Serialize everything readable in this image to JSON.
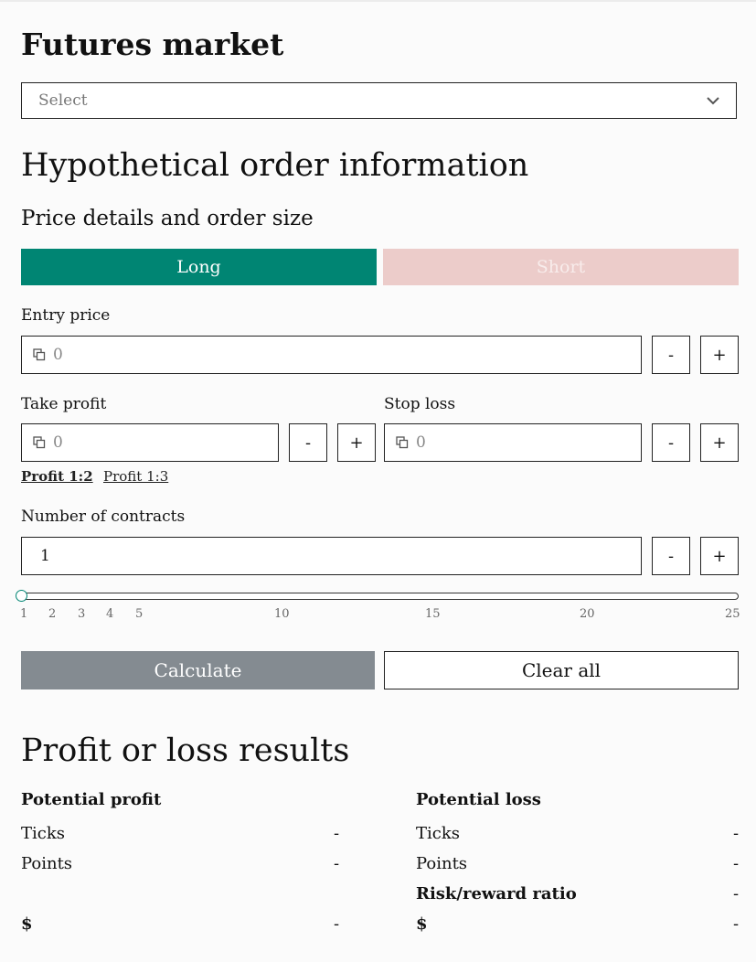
{
  "futures": {
    "title": "Futures market",
    "select_placeholder": "Select",
    "chevron_icon": "chevron-down-icon"
  },
  "order": {
    "title": "Hypothetical order information",
    "subtitle": "Price details and order size",
    "tabs": {
      "long": "Long",
      "short": "Short"
    },
    "colors": {
      "long": "#008573",
      "short": "#ecccca"
    }
  },
  "entry": {
    "label": "Entry price",
    "value": "0",
    "minus": "-",
    "plus": "+"
  },
  "take_profit": {
    "label": "Take profit",
    "value": "0",
    "minus": "-",
    "plus": "+"
  },
  "stop_loss": {
    "label": "Stop loss",
    "value": "0",
    "minus": "-",
    "plus": "+"
  },
  "profit_links": {
    "p12": "Profit 1:2",
    "p13": "Profit 1:3"
  },
  "contracts": {
    "label": "Number of contracts",
    "value": "1",
    "minus": "-",
    "plus": "+",
    "slider_value": 1,
    "slider_min": 1,
    "slider_max": 25,
    "ticks": [
      "1",
      "2",
      "3",
      "4",
      "5",
      "10",
      "15",
      "20",
      "25"
    ]
  },
  "actions": {
    "calculate": "Calculate",
    "clear": "Clear all"
  },
  "results": {
    "title": "Profit or loss results",
    "profit": {
      "heading": "Potential profit",
      "ticks_label": "Ticks",
      "ticks_value": "-",
      "points_label": "Points",
      "points_value": "-",
      "dollar_label": "$",
      "dollar_value": "-"
    },
    "loss": {
      "heading": "Potential loss",
      "ticks_label": "Ticks",
      "ticks_value": "-",
      "points_label": "Points",
      "points_value": "-",
      "risk_label": "Risk/reward ratio",
      "risk_value": "-",
      "dollar_label": "$",
      "dollar_value": "-"
    }
  }
}
